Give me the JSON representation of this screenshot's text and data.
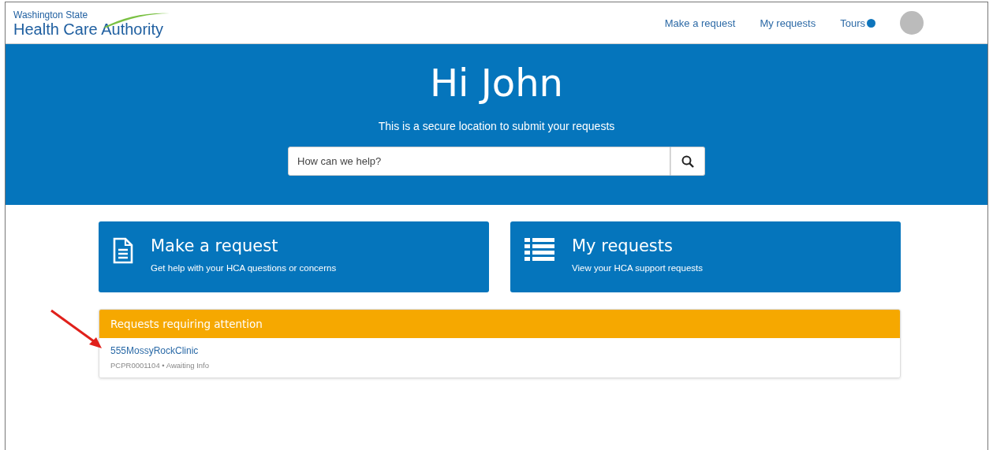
{
  "logo": {
    "line_1": "Washington State",
    "line_2": "Health Care Authority"
  },
  "nav": [
    {
      "label": "Make a request",
      "dot": false
    },
    {
      "label": "My requests",
      "dot": false
    },
    {
      "label": "Tours",
      "dot": true
    }
  ],
  "hero": {
    "title": "Hi John",
    "subtitle": "This is a secure location to submit your requests",
    "search": {
      "placeholder": "How can we help?"
    }
  },
  "cards": [
    {
      "kind": "document",
      "title": "Make a request",
      "text": "Get help with your HCA questions or concerns"
    },
    {
      "kind": "list",
      "title": "My requests",
      "text": "View your HCA support requests"
    }
  ],
  "attention": {
    "title": "Requests requiring attention",
    "items": [
      {
        "name": "555MossyRockClinic",
        "detail": "PCPR0001104 • Awaiting Info"
      }
    ]
  }
}
